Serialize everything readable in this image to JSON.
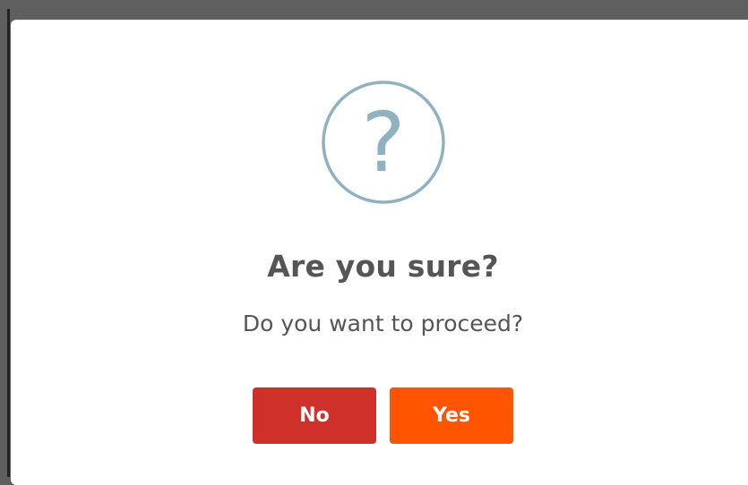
{
  "dialog": {
    "icon": "question-icon",
    "icon_glyph": "?",
    "title": "Are you sure?",
    "message": "Do you want to proceed?",
    "cancel_label": "No",
    "confirm_label": "Yes"
  },
  "colors": {
    "icon_stroke": "#8fb1c0",
    "cancel_bg": "#d0302a",
    "confirm_bg": "#ff5500",
    "backdrop": "#5f5f5f"
  }
}
